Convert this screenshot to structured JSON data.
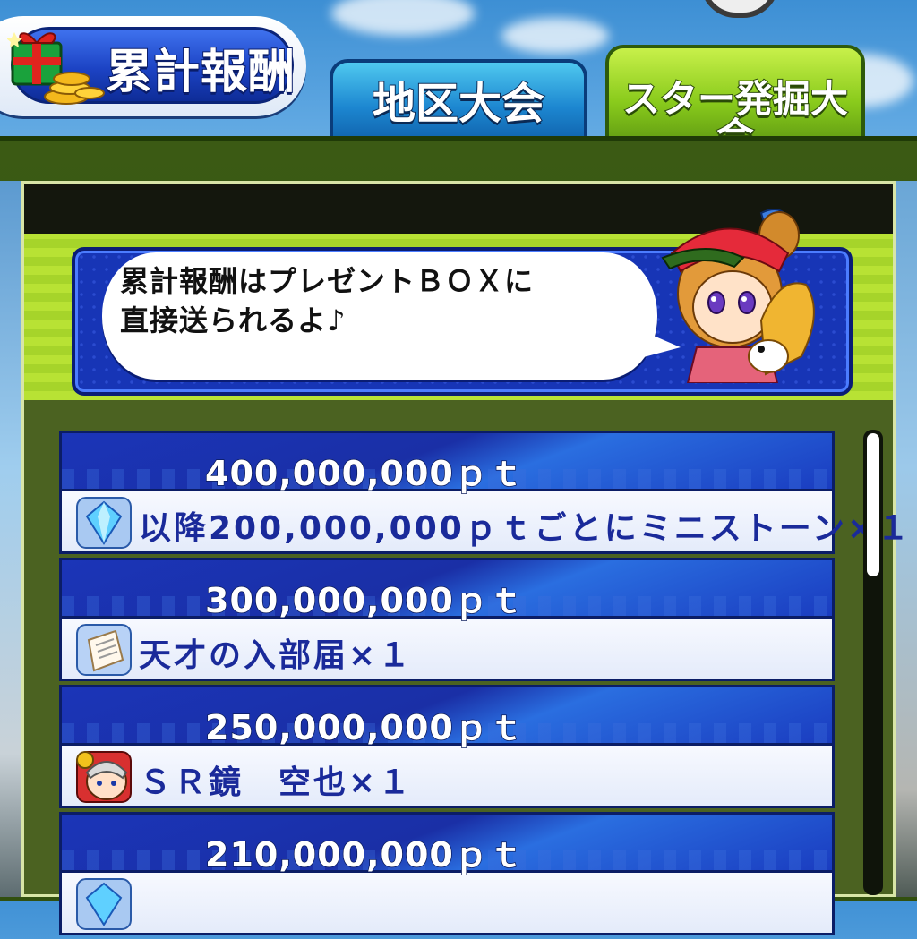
{
  "header": {
    "reward_banner_label": "累計報酬",
    "tabs": [
      {
        "label": "地区大会",
        "active": false
      },
      {
        "label": "スター発掘大会",
        "active": true
      }
    ]
  },
  "message": {
    "line1": "累計報酬はプレゼントＢＯＸに",
    "line2": "直接送られるよ♪"
  },
  "rewards": [
    {
      "points": "400,000,000ｐｔ",
      "item": "以降200,000,000ｐｔごとにミニストーン×１",
      "icon": "ministone-icon"
    },
    {
      "points": "300,000,000ｐｔ",
      "item": "天才の入部届×１",
      "icon": "application-form-icon"
    },
    {
      "points": "250,000,000ｐｔ",
      "item": "ＳＲ鏡　空也×１",
      "icon": "sr-character-card-icon"
    },
    {
      "points": "210,000,000ｐｔ",
      "item": "",
      "icon": "ministone-icon"
    }
  ],
  "scroll": {
    "position_fraction": 0
  }
}
